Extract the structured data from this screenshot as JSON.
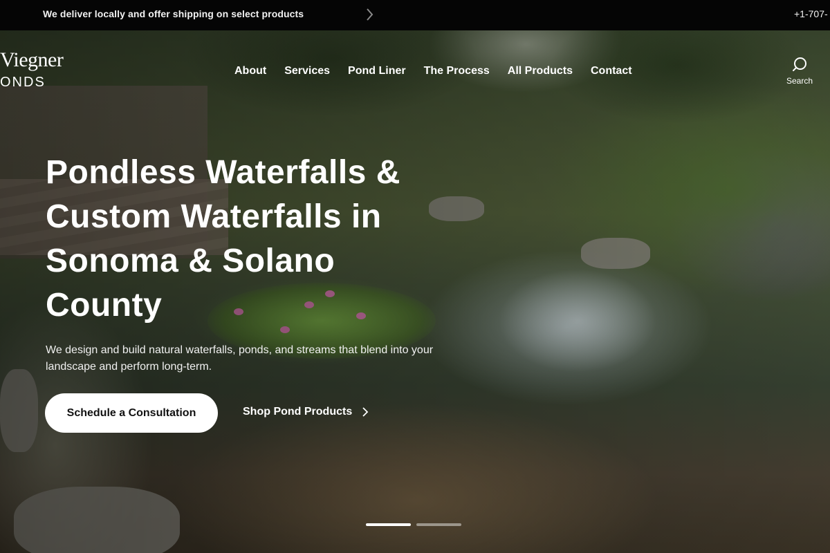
{
  "announcement": {
    "message": "We deliver locally and offer shipping on select products",
    "phone": "+1-707-"
  },
  "logo": {
    "line1": "Viegner",
    "line2": "ONDS"
  },
  "nav": {
    "items": [
      "About",
      "Services",
      "Pond Liner",
      "The Process",
      "All Products",
      "Contact"
    ],
    "search_label": "Search"
  },
  "hero": {
    "headline": "Pondless Waterfalls & Custom Waterfalls in Sonoma & Solano County",
    "subtext": "We design and build natural waterfalls, ponds, and streams that blend into your landscape and perform long-term.",
    "primary_cta": "Schedule a Consultation",
    "secondary_cta": "Shop Pond Products",
    "slides_total": 2,
    "active_slide": 1
  },
  "colors": {
    "topbar_bg": "#050505",
    "cta_bg": "#ffffff",
    "cta_text": "#111111"
  },
  "icons": [
    "chevron-right-icon",
    "search-icon"
  ]
}
